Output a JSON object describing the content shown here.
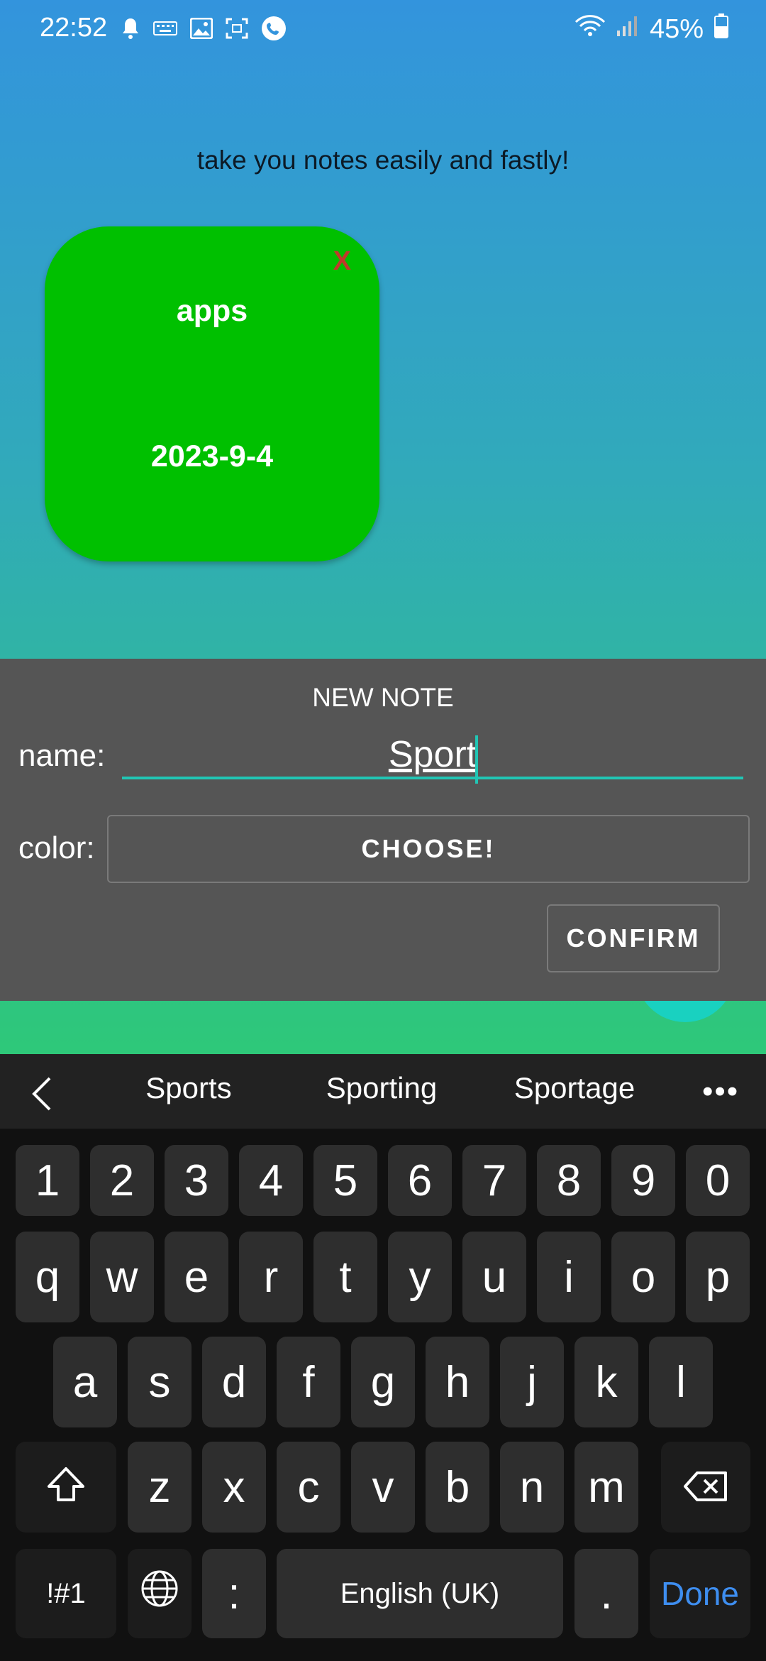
{
  "status_bar": {
    "time": "22:52",
    "battery": "45%"
  },
  "app": {
    "tagline": "take you notes easily and fastly!",
    "notes": [
      {
        "name": "apps",
        "date": "2023-9-4",
        "close": "X",
        "color": "#00c000"
      }
    ]
  },
  "dialog": {
    "title": "NEW NOTE",
    "name_label": "name:",
    "name_value": "Sport",
    "color_label": "color:",
    "choose_label": "CHOOSE!",
    "confirm_label": "CONFIRM"
  },
  "keyboard": {
    "suggestions": [
      "Sports",
      "Sporting",
      "Sportage"
    ],
    "more": "•••",
    "row_numbers": [
      "1",
      "2",
      "3",
      "4",
      "5",
      "6",
      "7",
      "8",
      "9",
      "0"
    ],
    "row_1": [
      "q",
      "w",
      "e",
      "r",
      "t",
      "y",
      "u",
      "i",
      "o",
      "p"
    ],
    "row_2": [
      "a",
      "s",
      "d",
      "f",
      "g",
      "h",
      "j",
      "k",
      "l"
    ],
    "row_3": [
      "z",
      "x",
      "c",
      "v",
      "b",
      "n",
      "m"
    ],
    "symbols_key": "!#1",
    "colon_key": ":",
    "space_key": "English (UK)",
    "period_key": ".",
    "done_key": "Done"
  },
  "colors": {
    "accent": "#21c6b5",
    "dialog_bg": "#555555",
    "keyboard_bg": "#111111",
    "done": "#3e8ef0"
  }
}
